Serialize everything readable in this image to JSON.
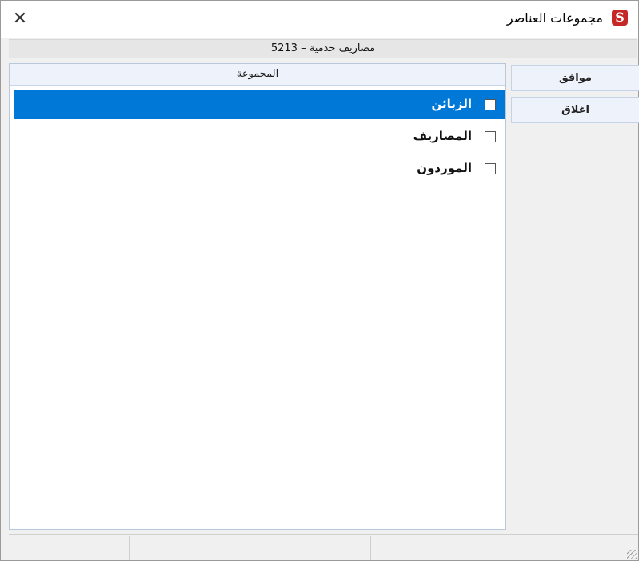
{
  "window": {
    "title": "مجموعات العناصر",
    "close_glyph": "✕",
    "logo_icon": "app-logo-icon",
    "logo_text": "S"
  },
  "subheader": {
    "text": "5213 – مصاريف خدمية"
  },
  "buttons": {
    "ok": "موافق",
    "close": "اغلاق"
  },
  "grid": {
    "column_header": "المجموعة",
    "rows": [
      {
        "label": "الزبائن",
        "checked": false,
        "selected": true
      },
      {
        "label": "المصاريف",
        "checked": false,
        "selected": false
      },
      {
        "label": "الموردون",
        "checked": false,
        "selected": false
      }
    ]
  },
  "colors": {
    "selection": "#0078d7",
    "logo": "#c62828",
    "button_bg": "#eef3fb"
  }
}
